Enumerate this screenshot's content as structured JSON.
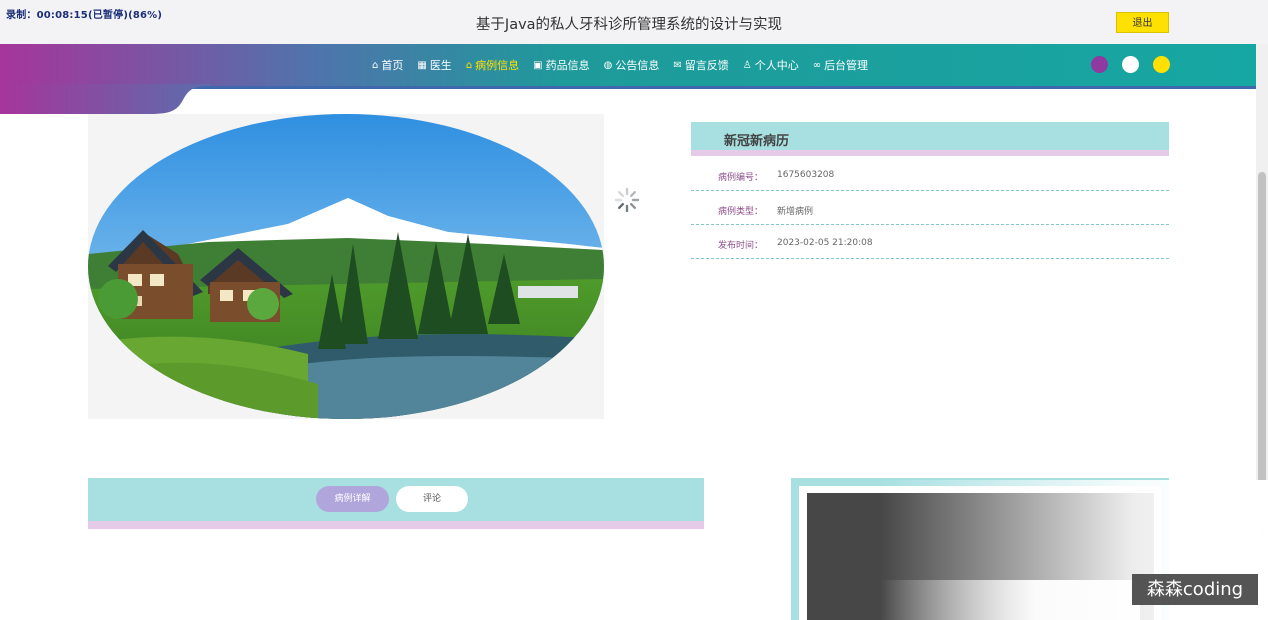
{
  "recording_timer": "录制：00:08:15(已暂停)(86%)",
  "site": {
    "title": "基于Java的私人牙科诊所管理系统的设计与实现",
    "logout_label": "退出"
  },
  "nav": {
    "items": [
      {
        "icon": "home-icon",
        "glyph": "⌂",
        "label": "首页",
        "active": false
      },
      {
        "icon": "doctor-icon",
        "glyph": "▦",
        "label": "医生",
        "active": false
      },
      {
        "icon": "case-icon",
        "glyph": "⌂",
        "label": "病例信息",
        "active": true
      },
      {
        "icon": "medicine-icon",
        "glyph": "▣",
        "label": "药品信息",
        "active": false
      },
      {
        "icon": "globe-icon",
        "glyph": "◍",
        "label": "公告信息",
        "active": false
      },
      {
        "icon": "mail-icon",
        "glyph": "✉",
        "label": "留言反馈",
        "active": false
      },
      {
        "icon": "user-icon",
        "glyph": "♙",
        "label": "个人中心",
        "active": false
      },
      {
        "icon": "link-icon",
        "glyph": "∞",
        "label": "后台管理",
        "active": false
      }
    ],
    "theme_colors": [
      "#8e3aa1",
      "#ffffff",
      "#ffe000"
    ]
  },
  "detail": {
    "title": "新冠新病历",
    "fields": [
      {
        "label": "病例编号：",
        "value": "1675603208"
      },
      {
        "label": "病例类型：",
        "value": "新增病例"
      },
      {
        "label": "发布时间：",
        "value": "2023-02-05 21:20:08"
      }
    ]
  },
  "tabs": [
    {
      "label": "病例详解",
      "active": true
    },
    {
      "label": "评论",
      "active": false
    }
  ],
  "watermark": "森森coding",
  "colors": {
    "accent_yellow": "#ffe100",
    "teal": "#17a7a3",
    "title_box": "#a8e0e2",
    "stripe_pink": "#e6cbe9",
    "tab_active": "#b0a6dc"
  }
}
